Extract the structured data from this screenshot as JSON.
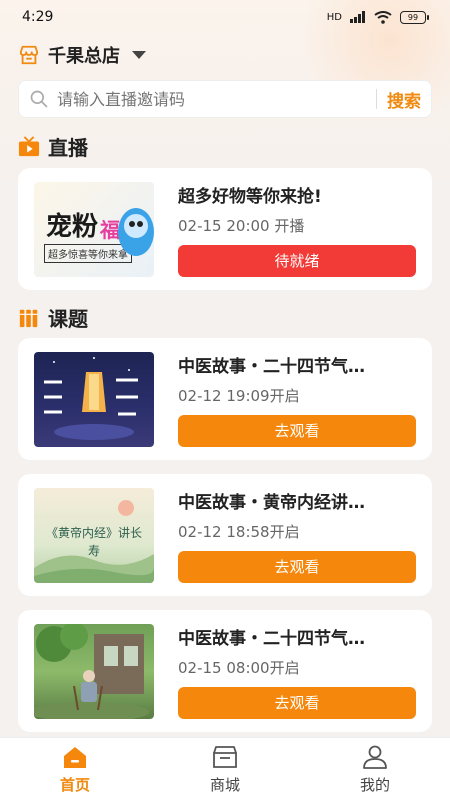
{
  "status": {
    "time": "4:29",
    "network": "HD",
    "battery": "99"
  },
  "store": {
    "name": "千果总店"
  },
  "search": {
    "placeholder": "请输入直播邀请码",
    "button": "搜索"
  },
  "live_section": {
    "title": "直播"
  },
  "live_item": {
    "title": "超多好物等你来抢!",
    "time": "02-15 20:00 开播",
    "button": "待就绪",
    "button_color": "#f23a36",
    "thumb_text_main": "宠粉",
    "thumb_text_accent": "福利",
    "thumb_text_sub": "超多惊喜等你来拿"
  },
  "course_section": {
    "title": "课题"
  },
  "courses": [
    {
      "title": "中医故事・二十四节气…",
      "time": "02-12 19:09开启",
      "button": "去观看"
    },
    {
      "title": "中医故事・黄帝内经讲…",
      "time": "02-12 18:58开启",
      "button": "去观看",
      "thumb_text": "《黄帝内经》讲长寿"
    },
    {
      "title": "中医故事・二十四节气…",
      "time": "02-15 08:00开启",
      "button": "去观看"
    }
  ],
  "course_button_color": "#f5880c",
  "tabbar": {
    "items": [
      {
        "label": "首页",
        "icon": "home-icon",
        "active": true
      },
      {
        "label": "商城",
        "icon": "shop-icon",
        "active": false
      },
      {
        "label": "我的",
        "icon": "profile-icon",
        "active": false
      }
    ]
  },
  "colors": {
    "accent": "#f08a10",
    "background": "#f5f1ee"
  }
}
